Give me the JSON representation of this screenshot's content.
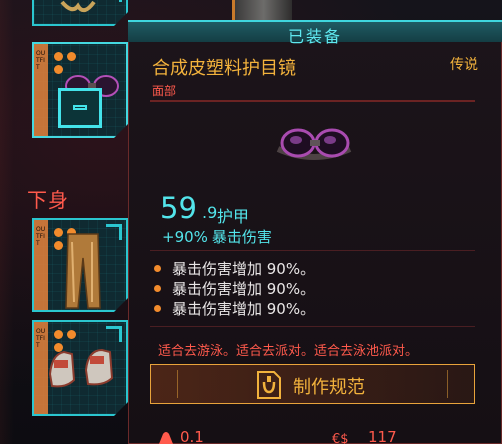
{
  "tooltip": {
    "equipped_label": "已装备",
    "item_name": "合成皮塑料护目镜",
    "rarity": "传说",
    "slot_type": "面部",
    "armor_value": "59",
    "armor_decimal": ".9",
    "armor_label": "护甲",
    "crit_bonus": "+90%",
    "crit_label": "暴击伤害",
    "stats": [
      "暴击伤害增加 90%。",
      "暴击伤害增加 90%。",
      "暴击伤害增加 90%。"
    ],
    "flavor": "适合去游泳。适合去派对。适合去泳池派对。",
    "craft_label": "制作规范",
    "weight": "0.1",
    "price": "117"
  },
  "inventory": {
    "section_label": "下身",
    "slot_tag_text": "OUTFIT"
  },
  "colors": {
    "cyan": "#53e4ea",
    "gold": "#f2b23c",
    "red": "#ff5a4c",
    "orange": "#f28b2c"
  },
  "icons": [
    "weight-icon",
    "eddies-icon",
    "crafting-spec-icon",
    "goggles-item-image",
    "pants-item-image",
    "shoes-item-image"
  ]
}
